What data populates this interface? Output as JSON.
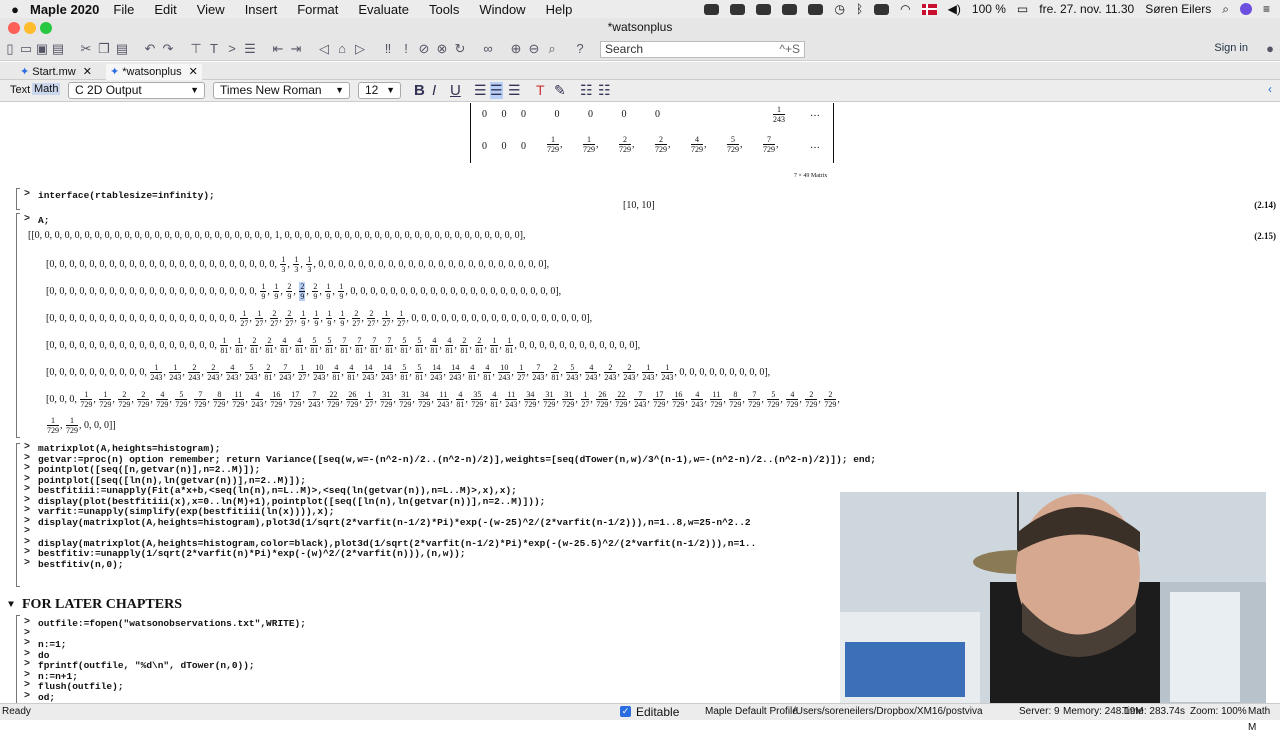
{
  "menubar": {
    "app_name": "Maple 2020",
    "items": [
      "File",
      "Edit",
      "View",
      "Insert",
      "Format",
      "Evaluate",
      "Tools",
      "Window",
      "Help"
    ],
    "battery": "100 %",
    "datetime": "fre. 27. nov. 11.30",
    "user": "Søren Eilers"
  },
  "window": {
    "title": "*watsonplus"
  },
  "toolbar": {
    "search_placeholder": "Search",
    "search_shortcut": "^+S",
    "signin": "Sign in"
  },
  "tabs": [
    {
      "label": "Start.mw"
    },
    {
      "label": "*watsonplus"
    }
  ],
  "format_bar": {
    "text_label": "Text",
    "math_label": "Math",
    "mode": "2D Output",
    "font": "Times New Roman",
    "size": "12"
  },
  "document": {
    "matrix_top_row1": [
      "0",
      "0",
      "0",
      "0",
      "0",
      "0",
      "0"
    ],
    "matrix_top_row1_last": "1/243",
    "matrix_top_row2": [
      "0",
      "0",
      "0"
    ],
    "matrix_top_row2_fracs": [
      "1/729",
      "1/729",
      "2/729",
      "2/729",
      "4/729",
      "5/729",
      "7/729"
    ],
    "matrix_caption": "7 × 49 Matrix",
    "cmd_interface": "interface(rtablesize=infinity);",
    "out_interface": "[10, 10]",
    "eq_214": "(2.14)",
    "cmd_A": "A;",
    "eq_215": "(2.15)",
    "row1": "[0, 0, 0, 0, 0, 0, 0, 0, 0, 0, 0, 0, 0, 0, 0, 0, 0, 0, 0, 0, 0, 0, 0, 0, 1, 0, 0, 0, 0, 0, 0, 0, 0, 0, 0, 0, 0, 0, 0, 0, 0, 0, 0, 0, 0, 0, 0, 0, 0],",
    "row2_pre": "[0, 0, 0, 0, 0, 0, 0, 0, 0, 0, 0, 0, 0, 0, 0, 0, 0, 0, 0, 0, 0, 0, 0, ",
    "row2_fracs": [
      "1/3",
      "1/3",
      "1/3"
    ],
    "row2_post": " 0, 0, 0, 0, 0, 0, 0, 0, 0, 0, 0, 0, 0, 0, 0, 0, 0, 0, 0, 0, 0, 0, 0],",
    "row3_pre": "[0, 0, 0, 0, 0, 0, 0, 0, 0, 0, 0, 0, 0, 0, 0, 0, 0, 0, 0, 0, 0, ",
    "row3_fracs": [
      "1/9",
      "1/9",
      "2/9",
      "2/9",
      "2/9",
      "1/9",
      "1/9"
    ],
    "row3_post": " 0, 0, 0, 0, 0, 0, 0, 0, 0, 0, 0, 0, 0, 0, 0, 0, 0, 0, 0, 0, 0],",
    "row4_pre": "[0, 0, 0, 0, 0, 0, 0, 0, 0, 0, 0, 0, 0, 0, 0, 0, 0, 0, 0, ",
    "row4_fracs": [
      "1/27",
      "1/27",
      "2/27",
      "2/27",
      "1/9",
      "1/9",
      "1/9",
      "1/9",
      "2/27",
      "2/27",
      "1/27",
      "1/27"
    ],
    "row4_post": " 0, 0, 0, 0, 0, 0, 0, 0, 0, 0, 0, 0, 0, 0, 0, 0, 0, 0],",
    "row5_pre": "[0, 0, 0, 0, 0, 0, 0, 0, 0, 0, 0, 0, 0, 0, 0, 0, 0, ",
    "row5_fracs": [
      "1/81",
      "1/81",
      "2/81",
      "2/81",
      "4/81",
      "4/81",
      "5/81",
      "5/81",
      "7/81",
      "7/81",
      "7/81",
      "7/81",
      "5/81",
      "5/81",
      "4/81",
      "4/81",
      "2/81",
      "2/81",
      "1/81",
      "1/81"
    ],
    "row5_post": " 0, 0, 0, 0, 0, 0, 0, 0, 0, 0, 0, 0],",
    "row6_pre": "[0, 0, 0, 0, 0, 0, 0, 0, 0, 0, ",
    "row6_fracs": [
      "1/243",
      "1/243",
      "2/243",
      "2/243",
      "4/243",
      "5/243",
      "2/81",
      "7/243",
      "1/27",
      "10/243",
      "4/81",
      "4/81",
      "14/243",
      "14/243",
      "5/81",
      "5/81",
      "14/243",
      "14/243",
      "4/81",
      "4/81",
      "10/243",
      "1/27",
      "7/243",
      "2/81",
      "5/243",
      "4/243",
      "2/243",
      "2/243",
      "1/243",
      "1/243"
    ],
    "row6_post": " 0, 0, 0, 0, 0, 0, 0, 0, 0],",
    "row7_pre": "[0, 0, 0, ",
    "row7_fracs": [
      "1/729",
      "1/729",
      "2/729",
      "2/729",
      "4/729",
      "5/729",
      "7/729",
      "8/729",
      "11/729",
      "4/243",
      "16/729",
      "17/729",
      "7/243",
      "22/729",
      "26/729",
      "1/27",
      "31/729",
      "31/729",
      "34/729",
      "11/243",
      "4/81",
      "35/729",
      "4/81",
      "11/243",
      "34/729",
      "31/729",
      "31/729",
      "1/27",
      "26/729",
      "22/729",
      "7/243",
      "17/729",
      "16/729",
      "4/243",
      "11/729",
      "8/729",
      "7/729",
      "5/729",
      "4/729",
      "2/729",
      "2/729"
    ],
    "row7b_fracs": [
      "1/729",
      "1/729"
    ],
    "row7b_post": " 0, 0, 0]]",
    "commands": [
      "matrixplot(A,heights=histogram);",
      "getvar:=proc(n) option remember; return Variance([seq(w,w=-(n^2-n)/2..(n^2-n)/2)],weights=[seq(dTower(n,w)/3^(n-1),w=-(n^2-n)/2..(n^2-n)/2)]); end;",
      "pointplot([seq([n,getvar(n)],n=2..M)]);",
      "pointplot([seq([ln(n),ln(getvar(n))],n=2..M)]);",
      "bestfitiii:=unapply(Fit(a*x+b,<seq(ln(n),n=L..M)>,<seq(ln(getvar(n)),n=L..M)>,x),x);",
      "display(plot(bestfitiii(x),x=0..ln(M)+1),pointplot([seq([ln(n),ln(getvar(n))],n=2..M)]));",
      "varfit:=unapply(simplify(exp(bestfitiii(ln(x)))),x);",
      "display(matrixplot(A,heights=histogram),plot3d(1/sqrt(2*varfit(n-1/2)*Pi)*exp(-(w-25)^2/(2*varfit(n-1/2))),n=1..8,w=25-n^2..2",
      "",
      "display(matrixplot(A,heights=histogram,color=black),plot3d(1/sqrt(2*varfit(n-1/2)*Pi)*exp(-(w-25.5)^2/(2*varfit(n-1/2))),n=1..",
      "bestfitiv:=unapply(1/sqrt(2*varfit(n)*Pi)*exp(-(w)^2/(2*varfit(n))),(n,w));",
      "bestfitiv(n,0);"
    ],
    "section_title": "FOR LATER CHAPTERS",
    "later_cmds": [
      "outfile:=fopen(\"watsonobservations.txt\",WRITE);",
      "",
      "n:=1;",
      "do",
      "  fprintf(outfile, \"%d\\n\", dTower(n,0));",
      "  n:=n+1;",
      "  flush(outfile);",
      "od;"
    ]
  },
  "statusbar": {
    "ready": "Ready",
    "editable": "Editable",
    "profile": "Maple Default Profile",
    "path": "/Users/soreneilers/Dropbox/XM16/postviva",
    "server": "Server: 9",
    "memory": "Memory: 248.19M",
    "time": "Time: 283.74s",
    "zoom": "Zoom: 100%",
    "mode": "Math M"
  },
  "colors": {
    "accent": "#2a6de0",
    "highlight": "#b8d0f8",
    "close_red": "#fe5f57",
    "min_yellow": "#febc2e",
    "max_green": "#28c840"
  }
}
